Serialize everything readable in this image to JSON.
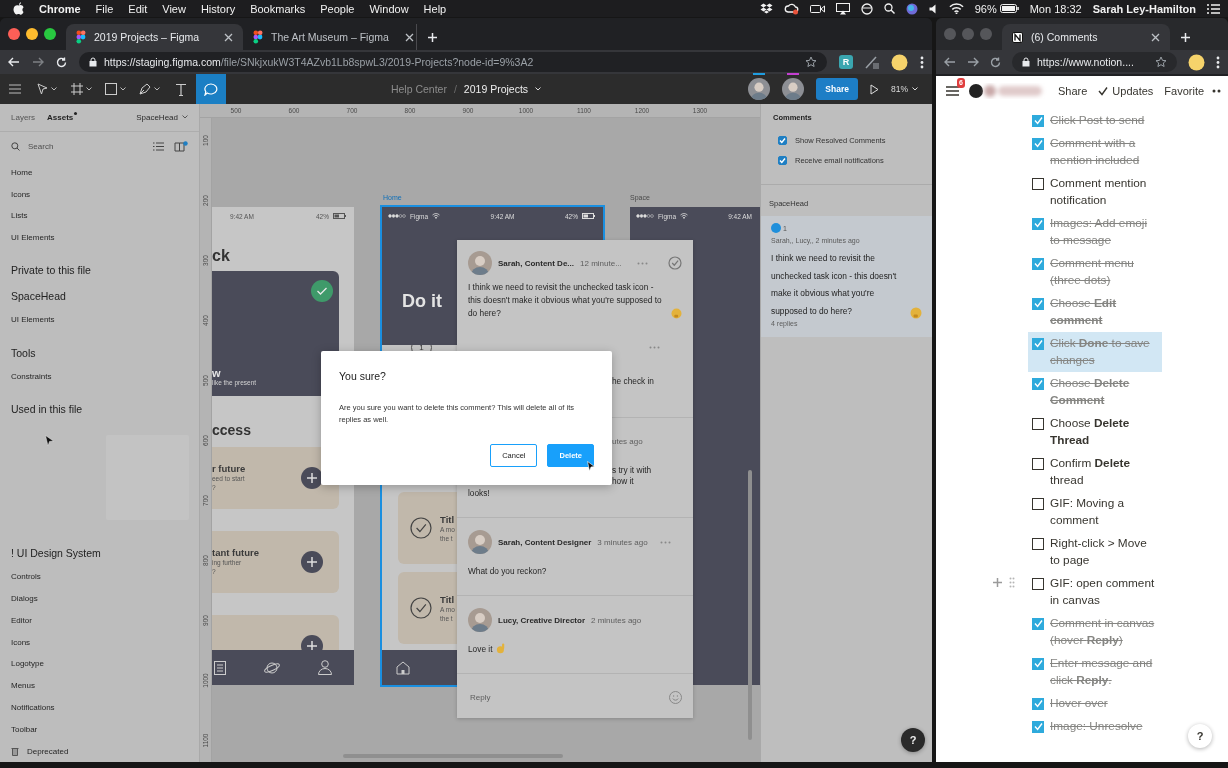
{
  "menu_bar": {
    "app": "Chrome",
    "menus": [
      "File",
      "Edit",
      "View",
      "History",
      "Bookmarks",
      "People",
      "Window",
      "Help"
    ],
    "battery": "96%",
    "clock": "Mon 18:32",
    "user": "Sarah Ley-Hamilton"
  },
  "figma_window": {
    "tabs": [
      {
        "title": "2019 Projects – Figma",
        "selected": true
      },
      {
        "title": "The Art Museum – Figma",
        "selected": false
      }
    ],
    "url": {
      "host": "https://staging.figma.com",
      "path": "/file/SNkjxukW3T4AZvb1Lb8spwL3/2019-Projects?node-id=9%3A2"
    },
    "extension": "R",
    "tools": [
      {
        "kind": "move",
        "selected": false
      },
      {
        "kind": "frame",
        "selected": false
      },
      {
        "kind": "shape",
        "selected": false
      },
      {
        "kind": "pen",
        "selected": false
      },
      {
        "kind": "text",
        "selected": false
      },
      {
        "kind": "comment",
        "selected": true
      }
    ],
    "breadcrumb": {
      "team": "Help Center",
      "separator": "/",
      "file": "2019 Projects"
    },
    "share": "Share",
    "zoom": "81%"
  },
  "assets_panel": {
    "tabs": [
      {
        "label": "Layers",
        "selected": false,
        "dot": false
      },
      {
        "label": "Assets",
        "selected": true,
        "dot": true
      }
    ],
    "library": "SpaceHead",
    "search": {
      "placeholder": "Search"
    },
    "entries": [
      {
        "kind": "item",
        "label": "Home"
      },
      {
        "kind": "item",
        "label": "Icons"
      },
      {
        "kind": "item",
        "label": "Lists"
      },
      {
        "kind": "item",
        "label": "UI Elements"
      },
      {
        "kind": "heading",
        "label": "Private to this file"
      },
      {
        "kind": "heading",
        "label": "SpaceHead"
      },
      {
        "kind": "item",
        "label": "UI Elements"
      },
      {
        "kind": "heading",
        "label": "Tools"
      },
      {
        "kind": "item",
        "label": "Constraints"
      },
      {
        "kind": "heading",
        "label": "Used in this file"
      },
      {
        "kind": "thumbnail"
      },
      {
        "kind": "heading",
        "label": "! UI Design System"
      },
      {
        "kind": "item",
        "label": "Controls"
      },
      {
        "kind": "item",
        "label": "Dialogs"
      },
      {
        "kind": "item",
        "label": "Editor"
      },
      {
        "kind": "item",
        "label": "Icons"
      },
      {
        "kind": "item",
        "label": "Logotype"
      },
      {
        "kind": "item",
        "label": "Menus"
      },
      {
        "kind": "item",
        "label": "Notifications"
      },
      {
        "kind": "item",
        "label": "Toolbar"
      },
      {
        "kind": "deprecated",
        "label": "Deprecated"
      }
    ]
  },
  "canvas": {
    "top_ruler": [
      "500",
      "600",
      "700",
      "800",
      "900",
      "1000",
      "1100",
      "1200",
      "1300"
    ],
    "left_ruler": [
      "100",
      "200",
      "300",
      "400",
      "500",
      "600",
      "700",
      "800",
      "900",
      "1000",
      "1100"
    ],
    "left_frame": {
      "time": "9:42 AM",
      "battery": "42%",
      "heading": "ck",
      "card": {
        "title": "w",
        "subtitle": "like the present",
        "done": true
      },
      "section": "ccess",
      "tasks": [
        {
          "kind": "text",
          "title": "r future",
          "lines": [
            "eed to start",
            "?"
          ]
        },
        {
          "kind": "text",
          "title": "tant future",
          "lines": [
            "ing further",
            "?"
          ]
        },
        {
          "kind": "blank"
        }
      ]
    },
    "home_frame": {
      "label": "Home",
      "selected": true,
      "carrier": "Figma",
      "time": "9:42 AM",
      "battery": "42%",
      "heading": "Do it",
      "step": "1",
      "tasks": [
        {
          "title": "Titl",
          "lines": [
            "A mo",
            "the t"
          ]
        },
        {
          "title": "Titl",
          "lines": [
            "A mo",
            "the t"
          ]
        }
      ]
    },
    "space_frame": {
      "label": "Space",
      "selected": false,
      "carrier": "Figma",
      "time": "9:42 AM"
    },
    "thread": {
      "comments": [
        {
          "kind": "full",
          "author": "Sarah, Content De...",
          "time": "12 minute...",
          "body": "I think we need to revisit the unchecked task icon - this doesn't make it obvious what you're supposed to do here?",
          "emoji": {
            "kind": "thinking"
          },
          "menu": true,
          "resolve": true
        },
        {
          "kind": "covered",
          "menu": true,
          "fragments": [
            "he check in"
          ]
        },
        {
          "kind": "covered",
          "time": "utes ago",
          "fragments": [
            "s try it with",
            "how it"
          ],
          "tail": "looks!"
        },
        {
          "kind": "full",
          "author": "Sarah, Content Designer",
          "time": "3 minutes ago",
          "body": "What do you reckon?",
          "menu": true
        },
        {
          "kind": "full",
          "author": "Lucy, Creative Director",
          "time": "2 minutes ago",
          "body": "Love it",
          "emoji": {
            "kind": "ok-hand"
          }
        }
      ],
      "reply_placeholder": "Reply"
    },
    "dialog": {
      "title": "You sure?",
      "message": "Are you sure you want to delete this comment? This will delete all of its replies as well.",
      "buttons": [
        {
          "label": "Cancel",
          "kind": "secondary"
        },
        {
          "label": "Delete",
          "kind": "primary"
        }
      ]
    }
  },
  "comments_panel": {
    "title": "Comments",
    "options": [
      {
        "label": "Show Resolved Comments",
        "checked": true
      },
      {
        "label": "Receive email notifications",
        "checked": true
      }
    ],
    "page": "SpaceHead",
    "threads": [
      {
        "pin": "1",
        "meta": "Sarah,, Lucy,, 2 minutes ago",
        "body": "I think we need to revisit the unchecked task icon - this doesn't make it obvious what you're supposed to do here?",
        "emoji": {
          "kind": "thinking"
        },
        "replies": "4 replies",
        "selected": true
      }
    ]
  },
  "help": "?",
  "notion_window": {
    "tab": "(6) Comments",
    "url": "https://www.notion....",
    "badge": "6",
    "actions": [
      {
        "label": "Share",
        "kind": "plain"
      },
      {
        "label": "Updates",
        "kind": "check"
      },
      {
        "label": "Favorite",
        "kind": "plain"
      }
    ],
    "help": "?",
    "todos": [
      {
        "text": "Click Post to send",
        "checked": true,
        "selected": false,
        "hovered": false
      },
      {
        "text": "Comment with a mention included",
        "checked": true,
        "selected": false,
        "hovered": false
      },
      {
        "text": "Comment mention notification",
        "checked": false,
        "selected": false,
        "hovered": false
      },
      {
        "text": "Images: Add emoji to message",
        "checked": true,
        "selected": false,
        "hovered": false
      },
      {
        "text": "Comment menu (three dots)",
        "checked": true,
        "selected": false,
        "hovered": false
      },
      {
        "text": "Choose **Edit comment**",
        "checked": true,
        "selected": false,
        "hovered": false
      },
      {
        "text": "Click **Done** to save changes",
        "checked": true,
        "selected": true,
        "hovered": false
      },
      {
        "text": "Choose **Delete Comment**",
        "checked": true,
        "selected": false,
        "hovered": false
      },
      {
        "text": "Choose **Delete Thread**",
        "checked": false,
        "selected": false,
        "hovered": false
      },
      {
        "text": "Confirm **Delete** thread",
        "checked": false,
        "selected": false,
        "hovered": false
      },
      {
        "text": "GIF: Moving a comment",
        "checked": false,
        "selected": false,
        "hovered": false
      },
      {
        "text": "Right-click > Move to page",
        "checked": false,
        "selected": false,
        "hovered": false
      },
      {
        "text": "GIF: open comment in canvas",
        "checked": false,
        "selected": false,
        "hovered": true
      },
      {
        "text": "Comment in canvas (hover **Reply**)",
        "checked": true,
        "selected": false,
        "hovered": false
      },
      {
        "text": "Enter message and click **Reply**.",
        "checked": true,
        "selected": false,
        "hovered": false
      },
      {
        "text": "Hover over",
        "checked": true,
        "selected": false,
        "hovered": false
      },
      {
        "text": "Image: Unresolve",
        "checked": true,
        "selected": false,
        "hovered": false
      }
    ]
  }
}
